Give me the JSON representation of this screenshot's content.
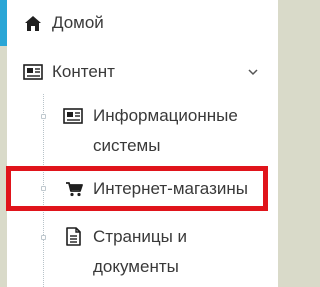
{
  "menu": {
    "home": {
      "label": "Домой",
      "icon": "home-icon"
    },
    "content": {
      "label": "Контент",
      "icon": "newspaper-icon",
      "expanded": true,
      "chevron": "chevron-down-icon"
    },
    "subitems": [
      {
        "label_line1": "Информационные",
        "label_line2": "системы",
        "icon": "newspaper-icon"
      },
      {
        "label": "Интернет-магазины",
        "icon": "cart-icon",
        "highlighted": true
      },
      {
        "label_line1": "Страницы и",
        "label_line2": "документы",
        "icon": "document-icon"
      }
    ]
  },
  "colors": {
    "accent_strip": "#2aa6d6",
    "highlight_border": "#e0141b",
    "text": "#393939",
    "background_outside": "#d9dac9"
  }
}
